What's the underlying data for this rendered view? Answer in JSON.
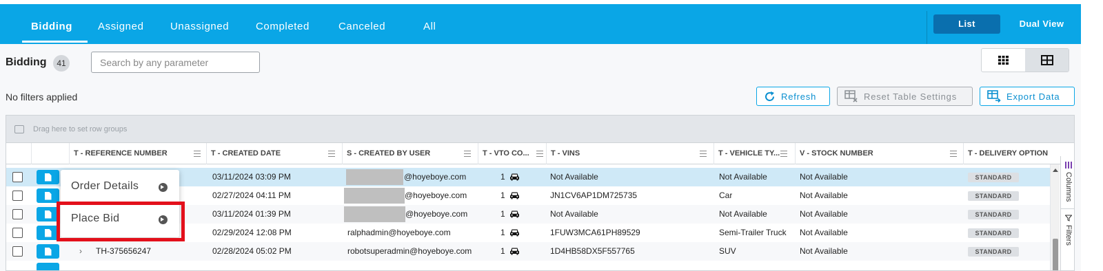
{
  "nav": {
    "tabs": [
      {
        "label": "Bidding",
        "active": true
      },
      {
        "label": "Assigned"
      },
      {
        "label": "Unassigned"
      },
      {
        "label": "Completed"
      },
      {
        "label": "Canceled"
      },
      {
        "label": "All"
      }
    ],
    "view_list": "List",
    "view_dual": "Dual View"
  },
  "page": {
    "title": "Bidding",
    "count": "41",
    "search_placeholder": "Search by any parameter",
    "filters_text": "No filters applied"
  },
  "actions": {
    "refresh": "Refresh",
    "reset": "Reset Table Settings",
    "export": "Export Data"
  },
  "grid": {
    "group_hint": "Drag here to set row groups",
    "columns": [
      "T - REFERENCE NUMBER",
      "T - CREATED DATE",
      "S - CREATED BY USER",
      "T - VTO CO...",
      "T - VINS",
      "T - VEHICLE TY...",
      "V - STOCK NUMBER",
      "T - DELIVERY OPTION"
    ],
    "rows": [
      {
        "ref": "",
        "date": "03/11/2024 03:09 PM",
        "user": "@hoyeboye.com",
        "vto": "1",
        "vin": "Not Available",
        "vtype": "Not Available",
        "stock": "Not Available",
        "delivery": "STANDARD",
        "selected": true
      },
      {
        "ref": "",
        "date": "02/27/2024 04:11 PM",
        "user": "@hoyeboye.com",
        "vto": "1",
        "vin": "JN1CV6AP1DM725735",
        "vtype": "Car",
        "stock": "Not Available",
        "delivery": "STANDARD"
      },
      {
        "ref": "",
        "date": "03/11/2024 01:39 PM",
        "user": "@hoyeboye.com",
        "vto": "1",
        "vin": "Not Available",
        "vtype": "Not Available",
        "stock": "Not Available",
        "delivery": "STANDARD"
      },
      {
        "ref": "",
        "date": "02/29/2024 12:08 PM",
        "user": "ralphadmin@hoyeboye.com",
        "vto": "1",
        "vin": "1FUW3MCA61PH89529",
        "vtype": "Semi-Trailer Truck",
        "stock": "Not Available",
        "delivery": "STANDARD"
      },
      {
        "ref": "TH-375656247",
        "date": "02/28/2024 05:02 PM",
        "user": "robotsuperadmin@hoyeboye.com",
        "vto": "1",
        "vin": "1D4HB58DX5F557765",
        "vtype": "SUV",
        "stock": "Not Available",
        "delivery": "STANDARD"
      }
    ]
  },
  "side_panel": {
    "columns": "Columns",
    "filters": "Filters"
  },
  "context_menu": {
    "items": [
      "Order Details",
      "Place Bid"
    ]
  },
  "colors": {
    "brand": "#0aa6e6",
    "active_view": "#0a6fae",
    "highlight": "#e3101b"
  }
}
